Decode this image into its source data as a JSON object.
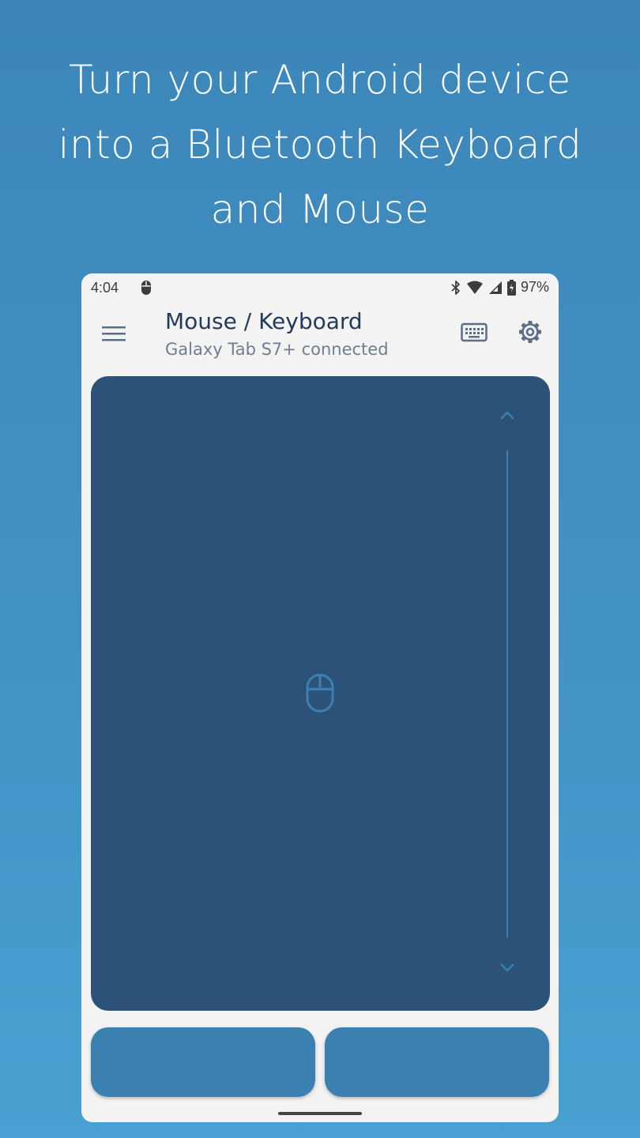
{
  "headline": {
    "line1": "Turn your Android device",
    "line2": "into a Bluetooth Keyboard",
    "line3": "and Mouse"
  },
  "status_bar": {
    "time": "4:04",
    "battery_percent": "97%",
    "icons": [
      "mouse-icon",
      "bluetooth-icon",
      "wifi-icon",
      "cell-signal-icon",
      "battery-icon"
    ]
  },
  "app_bar": {
    "title": "Mouse / Keyboard",
    "subtitle": "Galaxy Tab S7+ connected",
    "icons": [
      "menu-icon",
      "keyboard-icon",
      "gear-icon"
    ]
  },
  "touchpad": {
    "icons": [
      "chevron-up-icon",
      "chevron-down-icon",
      "mouse-icon"
    ]
  },
  "colors": {
    "background_top": "#3c86b9",
    "background_bottom": "#48a1d2",
    "phone_surface": "#f3f3f3",
    "touchpad": "#2c5277",
    "accent": "#3b80b5",
    "click_button": "#3b80b0",
    "title_text": "#223b5c",
    "subtitle_text": "#6d7f91"
  }
}
